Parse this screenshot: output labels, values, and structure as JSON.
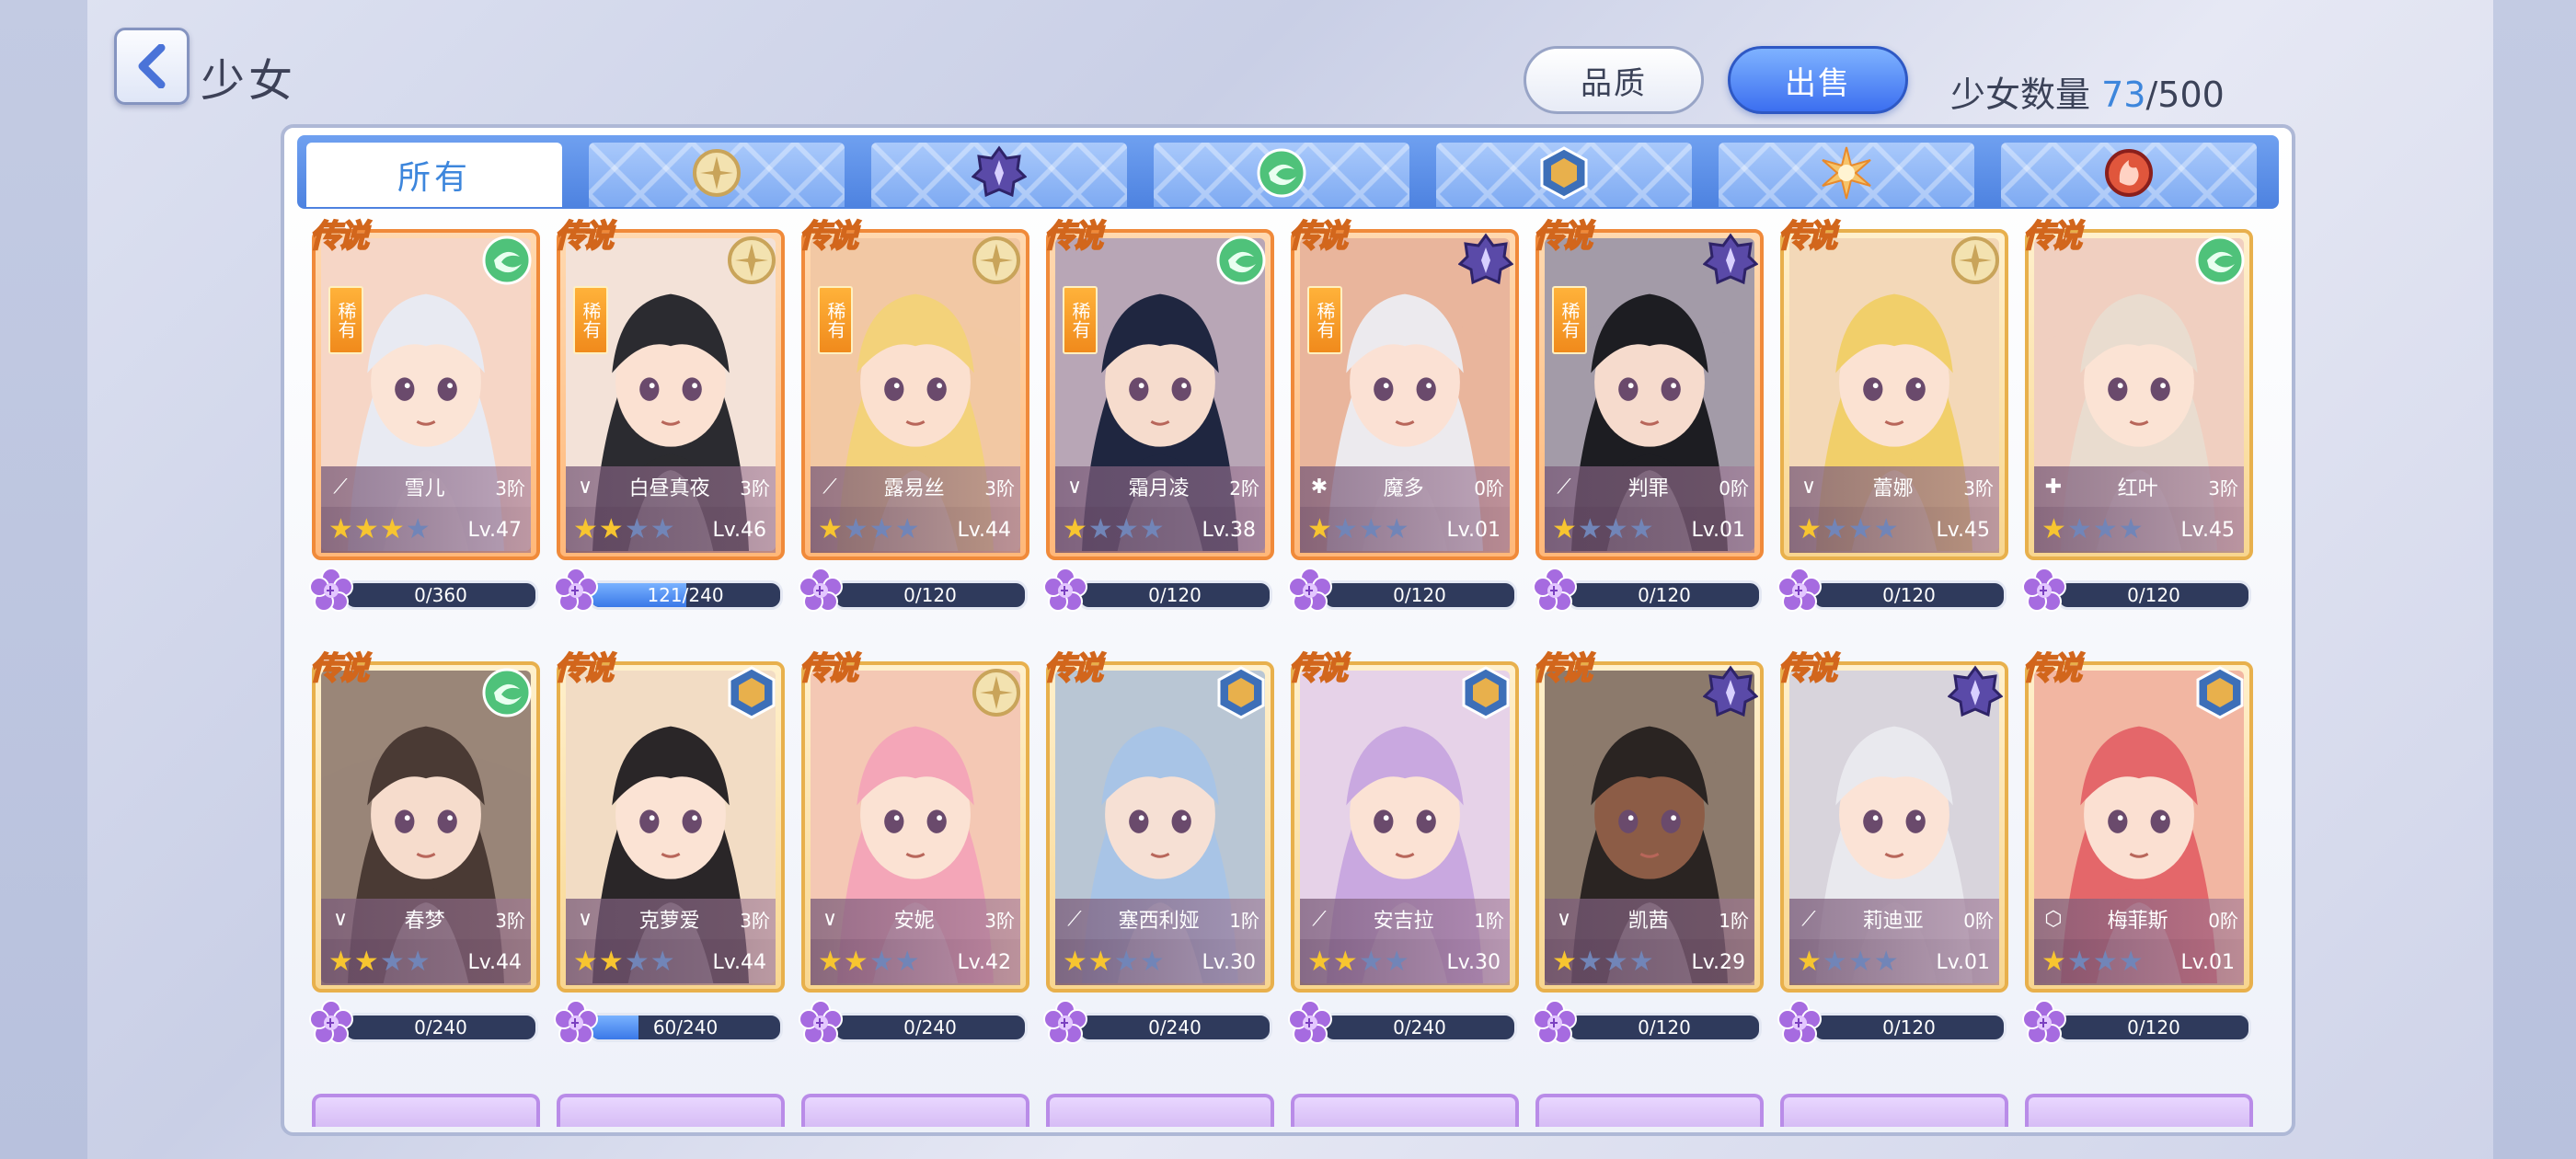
{
  "header": {
    "title": "少女",
    "quality_label": "品质",
    "sell_label": "出售",
    "count_label": "少女数量",
    "count_current": "73",
    "count_sep_max": "/500"
  },
  "tabs": [
    {
      "label": "所有",
      "icon": "all",
      "active": true
    },
    {
      "label": "",
      "icon": "light-element-icon"
    },
    {
      "label": "",
      "icon": "dark-element-icon"
    },
    {
      "label": "",
      "icon": "wind-element-icon"
    },
    {
      "label": "",
      "icon": "earth-element-icon"
    },
    {
      "label": "",
      "icon": "sun-element-icon"
    },
    {
      "label": "",
      "icon": "fire-element-icon"
    }
  ],
  "badge_legend": "传说",
  "rare_label": "稀有",
  "colors": {
    "accent": "#3d86dc",
    "orange_frame": "#f08a3a",
    "gold_frame": "#e8b04c",
    "star_on": "#f7c530",
    "star_off": "#7185b8"
  },
  "cards": [
    {
      "name": "雪儿",
      "tier": "3阶",
      "lv": "Lv.47",
      "stars": 3,
      "rare": true,
      "frame": "orange",
      "element": "wind",
      "cls": "bow",
      "xp": "0/360",
      "xp_fill": 0.0,
      "hair": "#e8eaf2",
      "skin": "#fbe4d6",
      "bg": "#f6d6c6"
    },
    {
      "name": "白昼真夜",
      "tier": "3阶",
      "lv": "Lv.46",
      "stars": 2,
      "rare": true,
      "frame": "orange",
      "element": "light",
      "cls": "wing",
      "xp": "121/240",
      "xp_fill": 0.504,
      "hair": "#2b2b30",
      "skin": "#fbe1d2",
      "bg": "#f3e2d8"
    },
    {
      "name": "露易丝",
      "tier": "3阶",
      "lv": "Lv.44",
      "stars": 1,
      "rare": true,
      "frame": "orange",
      "element": "light",
      "cls": "bow",
      "xp": "0/120",
      "xp_fill": 0.0,
      "hair": "#f3d27a",
      "skin": "#fbe0cf",
      "bg": "#f2c8a4"
    },
    {
      "name": "霜月凌",
      "tier": "2阶",
      "lv": "Lv.38",
      "stars": 1,
      "rare": true,
      "frame": "orange",
      "element": "wind",
      "cls": "wing",
      "xp": "0/120",
      "xp_fill": 0.0,
      "hair": "#1f2640",
      "skin": "#f6dccd",
      "bg": "#b8a6b6"
    },
    {
      "name": "魔多",
      "tier": "0阶",
      "lv": "Lv.01",
      "stars": 1,
      "rare": true,
      "frame": "orange",
      "element": "dark",
      "cls": "gear",
      "xp": "0/120",
      "xp_fill": 0.0,
      "hair": "#eceaee",
      "skin": "#fbe1d4",
      "bg": "#e9b59c"
    },
    {
      "name": "判罪",
      "tier": "0阶",
      "lv": "Lv.01",
      "stars": 1,
      "rare": true,
      "frame": "orange",
      "element": "dark",
      "cls": "bow",
      "xp": "0/120",
      "xp_fill": 0.0,
      "hair": "#1d1d22",
      "skin": "#f6dbcd",
      "bg": "#a39ba8"
    },
    {
      "name": "蕾娜",
      "tier": "3阶",
      "lv": "Lv.45",
      "stars": 1,
      "rare": false,
      "frame": "gold",
      "element": "light",
      "cls": "wing",
      "xp": "0/120",
      "xp_fill": 0.0,
      "hair": "#f1cf6a",
      "skin": "#fbe2d2",
      "bg": "#f3d8b8"
    },
    {
      "name": "红叶",
      "tier": "3阶",
      "lv": "Lv.45",
      "stars": 1,
      "rare": false,
      "frame": "gold",
      "element": "wind",
      "cls": "cross",
      "xp": "0/120",
      "xp_fill": 0.0,
      "hair": "#e9dccf",
      "skin": "#fbe3d4",
      "bg": "#f0cfc0"
    },
    {
      "name": "春梦",
      "tier": "3阶",
      "lv": "Lv.44",
      "stars": 2,
      "rare": false,
      "frame": "gold",
      "element": "wind",
      "cls": "wing",
      "xp": "0/240",
      "xp_fill": 0.0,
      "hair": "#4a3a34",
      "skin": "#f6dccc",
      "bg": "#9a8678"
    },
    {
      "name": "克萝爱",
      "tier": "3阶",
      "lv": "Lv.44",
      "stars": 2,
      "rare": false,
      "frame": "gold",
      "element": "earth",
      "cls": "wing",
      "xp": "60/240",
      "xp_fill": 0.25,
      "hair": "#2a2628",
      "skin": "#fbe3d4",
      "bg": "#f2dcc4"
    },
    {
      "name": "安妮",
      "tier": "3阶",
      "lv": "Lv.42",
      "stars": 2,
      "rare": false,
      "frame": "gold",
      "element": "light",
      "cls": "wing",
      "xp": "0/240",
      "xp_fill": 0.0,
      "hair": "#f4a6b8",
      "skin": "#fbe2d3",
      "bg": "#f4c8b4"
    },
    {
      "name": "塞西利娅",
      "tier": "1阶",
      "lv": "Lv.30",
      "stars": 2,
      "rare": false,
      "frame": "gold",
      "element": "earth",
      "cls": "bow",
      "xp": "0/240",
      "xp_fill": 0.0,
      "hair": "#a8c4e6",
      "skin": "#f6e0d4",
      "bg": "#b9c6d4"
    },
    {
      "name": "安吉拉",
      "tier": "1阶",
      "lv": "Lv.30",
      "stars": 2,
      "rare": false,
      "frame": "gold",
      "element": "earth",
      "cls": "bow",
      "xp": "0/240",
      "xp_fill": 0.0,
      "hair": "#c9a8e0",
      "skin": "#fbe2d4",
      "bg": "#e6d2e8"
    },
    {
      "name": "凯茜",
      "tier": "1阶",
      "lv": "Lv.29",
      "stars": 1,
      "rare": false,
      "frame": "gold",
      "element": "dark",
      "cls": "wing",
      "xp": "0/120",
      "xp_fill": 0.0,
      "hair": "#2a2422",
      "skin": "#8c5c46",
      "bg": "#8c7a6c"
    },
    {
      "name": "莉迪亚",
      "tier": "0阶",
      "lv": "Lv.01",
      "stars": 1,
      "rare": false,
      "frame": "gold",
      "element": "dark",
      "cls": "bow",
      "xp": "0/120",
      "xp_fill": 0.0,
      "hair": "#e9e9ee",
      "skin": "#fbe3d6",
      "bg": "#d8d4dc"
    },
    {
      "name": "梅菲斯",
      "tier": "0阶",
      "lv": "Lv.01",
      "stars": 1,
      "rare": false,
      "frame": "gold",
      "element": "earth",
      "cls": "shield",
      "xp": "0/120",
      "xp_fill": 0.0,
      "hair": "#e4676a",
      "skin": "#fbe0d2",
      "bg": "#f2b6a2"
    }
  ]
}
